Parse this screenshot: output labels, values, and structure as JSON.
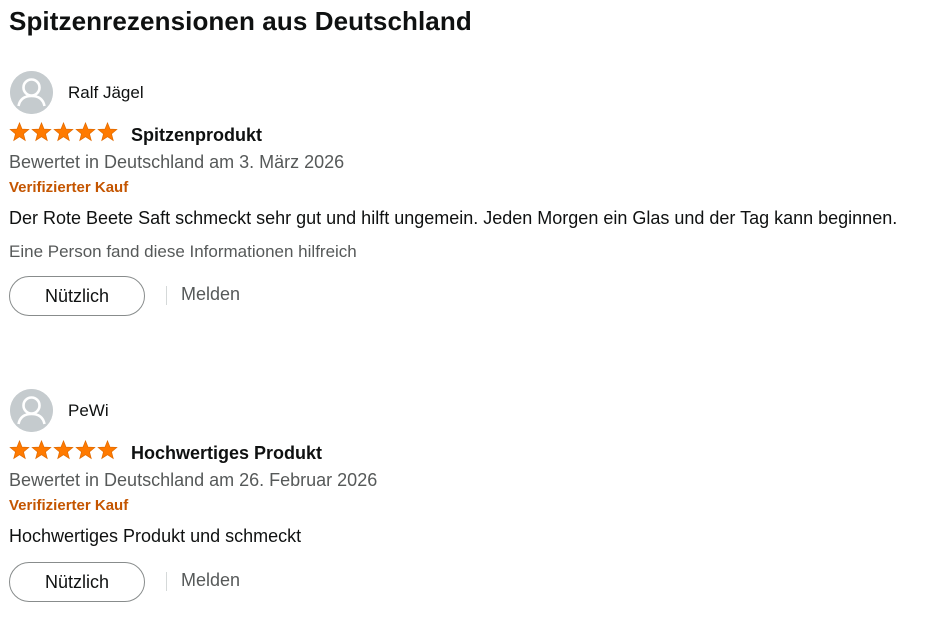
{
  "section": {
    "title": "Spitzenrezensionen aus Deutschland"
  },
  "colors": {
    "star": "#ff7a00",
    "verified": "#c45500",
    "muted": "#565959",
    "text": "#0f1111"
  },
  "reviews": [
    {
      "reviewer": "Ralf Jägel",
      "rating": 5,
      "title": "Spitzenprodukt",
      "date": "Bewertet in Deutschland am 3. März 2026",
      "verified": "Verifizierter Kauf",
      "body": "Der Rote Beete Saft schmeckt sehr gut und hilft ungemein. Jeden Morgen ein Glas und der Tag kann beginnen.",
      "helpful": "Eine Person fand diese Informationen hilfreich",
      "helpful_button": "Nützlich",
      "report": "Melden"
    },
    {
      "reviewer": "PeWi",
      "rating": 5,
      "title": "Hochwertiges Produkt",
      "date": "Bewertet in Deutschland am 26. Februar 2026",
      "verified": "Verifizierter Kauf",
      "body": "Hochwertiges Produkt und schmeckt",
      "helpful_button": "Nützlich",
      "report": "Melden"
    }
  ]
}
